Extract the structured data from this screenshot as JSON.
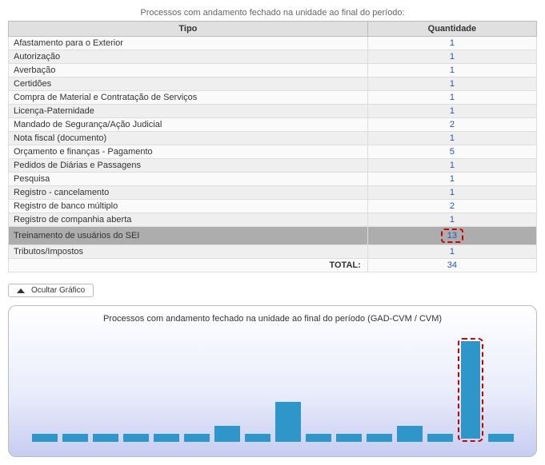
{
  "title": "Processos com andamento fechado na unidade ao final do período:",
  "columns": {
    "tipo": "Tipo",
    "quantidade": "Quantidade"
  },
  "rows": [
    {
      "tipo": "Afastamento para o Exterior",
      "qtd": 1
    },
    {
      "tipo": "Autorização",
      "qtd": 1
    },
    {
      "tipo": "Averbação",
      "qtd": 1
    },
    {
      "tipo": "Certidões",
      "qtd": 1
    },
    {
      "tipo": "Compra de Material e Contratação de Serviços",
      "qtd": 1
    },
    {
      "tipo": "Licença-Paternidade",
      "qtd": 1
    },
    {
      "tipo": "Mandado de Segurança/Ação Judicial",
      "qtd": 2
    },
    {
      "tipo": "Nota fiscal (documento)",
      "qtd": 1
    },
    {
      "tipo": "Orçamento e finanças - Pagamento",
      "qtd": 5
    },
    {
      "tipo": "Pedidos de Diárias e Passagens",
      "qtd": 1
    },
    {
      "tipo": "Pesquisa",
      "qtd": 1
    },
    {
      "tipo": "Registro - cancelamento",
      "qtd": 1
    },
    {
      "tipo": "Registro de banco múltiplo",
      "qtd": 2
    },
    {
      "tipo": "Registro de companhia aberta",
      "qtd": 1
    },
    {
      "tipo": "Treinamento de usuários do SEI",
      "qtd": 13,
      "highlight": true
    },
    {
      "tipo": "Tributos/Impostos",
      "qtd": 1
    }
  ],
  "total": {
    "label": "TOTAL:",
    "qtd": 34
  },
  "toggle_label": "Ocultar Gráfico",
  "chart_title": "Processos com andamento fechado na unidade ao final do período (GAD-CVM / CVM)",
  "chart_data": {
    "type": "bar",
    "categories": [
      "Afastamento para o Exterior",
      "Autorização",
      "Averbação",
      "Certidões",
      "Compra de Material e Contratação de Serviços",
      "Licença-Paternidade",
      "Mandado de Segurança/Ação Judicial",
      "Nota fiscal (documento)",
      "Orçamento e finanças - Pagamento",
      "Pedidos de Diárias e Passagens",
      "Pesquisa",
      "Registro - cancelamento",
      "Registro de banco múltiplo",
      "Registro de companhia aberta",
      "Treinamento de usuários do SEI",
      "Tributos/Impostos"
    ],
    "values": [
      1,
      1,
      1,
      1,
      1,
      1,
      2,
      1,
      5,
      1,
      1,
      1,
      2,
      1,
      13,
      1
    ],
    "highlight_index": 14,
    "title": "Processos com andamento fechado na unidade ao final do período (GAD-CVM / CVM)",
    "xlabel": "",
    "ylabel": "",
    "ylim": [
      0,
      13
    ]
  }
}
